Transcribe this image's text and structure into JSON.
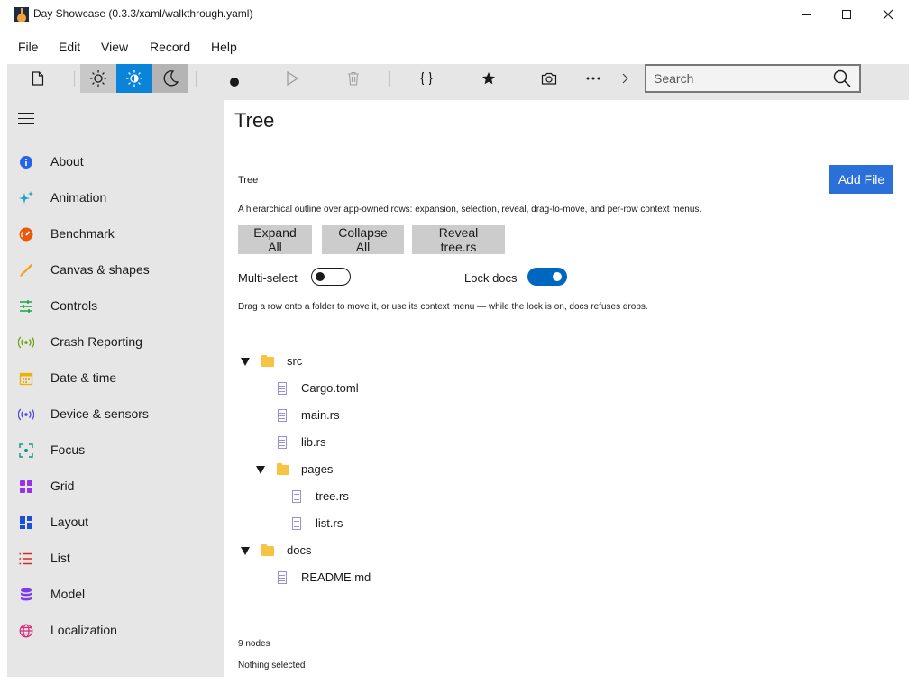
{
  "window": {
    "title": "Day Showcase (0.3.3/xaml/walkthrough.yaml)"
  },
  "menu": [
    "File",
    "Edit",
    "View",
    "Record",
    "Help"
  ],
  "toolbar": {
    "search_placeholder": "Search",
    "active_theme": "auto"
  },
  "sidebar": {
    "items": [
      {
        "label": "About",
        "icon": "info-icon",
        "color": "#2563eb"
      },
      {
        "label": "Animation",
        "icon": "sparkle-icon",
        "color": "#1aa3c9"
      },
      {
        "label": "Benchmark",
        "icon": "gauge-icon",
        "color": "#ea580c"
      },
      {
        "label": "Canvas & shapes",
        "icon": "brush-icon",
        "color": "#f59e0b"
      },
      {
        "label": "Controls",
        "icon": "sliders-icon",
        "color": "#16a34a"
      },
      {
        "label": "Crash Reporting",
        "icon": "broadcast-icon",
        "color": "#65a30d"
      },
      {
        "label": "Date & time",
        "icon": "calendar-icon",
        "color": "#eab308"
      },
      {
        "label": "Device & sensors",
        "icon": "sensor-icon",
        "color": "#4f46e5"
      },
      {
        "label": "Focus",
        "icon": "focus-icon",
        "color": "#0d9488"
      },
      {
        "label": "Grid",
        "icon": "grid-icon",
        "color": "#9333ea"
      },
      {
        "label": "Layout",
        "icon": "layout-icon",
        "color": "#1d4ed8"
      },
      {
        "label": "List",
        "icon": "list-icon",
        "color": "#dc2626"
      },
      {
        "label": "Model",
        "icon": "database-icon",
        "color": "#7c3aed"
      },
      {
        "label": "Localization",
        "icon": "globe-icon",
        "color": "#db2777"
      }
    ]
  },
  "page": {
    "title": "Tree",
    "section_title": "Tree",
    "add_file": "Add File",
    "description": "A hierarchical outline over app-owned rows: expansion, selection, reveal, drag-to-move, and per-row context menus.",
    "buttons": {
      "expand_all": "Expand All",
      "collapse_all": "Collapse All",
      "reveal": "Reveal tree.rs"
    },
    "multi_select": {
      "label": "Multi-select",
      "on": false
    },
    "lock_docs": {
      "label": "Lock docs",
      "on": true
    },
    "hint": "Drag a row onto a folder to move it, or use its context menu — while the lock is on, docs refuses drops.",
    "tree": [
      {
        "label": "src",
        "type": "folder",
        "depth": 0,
        "expanded": true
      },
      {
        "label": "Cargo.toml",
        "type": "file",
        "depth": 1
      },
      {
        "label": "main.rs",
        "type": "file",
        "depth": 1
      },
      {
        "label": "lib.rs",
        "type": "file",
        "depth": 1
      },
      {
        "label": "pages",
        "type": "folder",
        "depth": 1,
        "expanded": true
      },
      {
        "label": "tree.rs",
        "type": "file",
        "depth": 2
      },
      {
        "label": "list.rs",
        "type": "file",
        "depth": 2
      },
      {
        "label": "docs",
        "type": "folder",
        "depth": 0,
        "expanded": true
      },
      {
        "label": "README.md",
        "type": "file",
        "depth": 1
      }
    ],
    "node_count": "9 nodes",
    "selection": "Nothing selected"
  },
  "colors": {
    "accent": "#2b6fd8",
    "toggle_on": "#0067c0",
    "theme_active": "#0a84d8",
    "sidebar_bg": "#e6e6e6"
  }
}
